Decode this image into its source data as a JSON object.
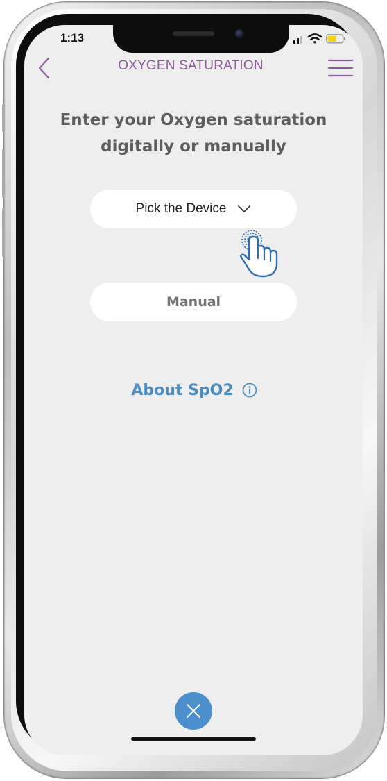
{
  "status_bar": {
    "time": "1:13",
    "battery_color": "#f5d30a"
  },
  "header": {
    "title": "OXYGEN SATURATION",
    "accent_color": "#8e5a9c",
    "back_icon": "chevron-left-icon",
    "menu_icon": "hamburger-menu-icon"
  },
  "main": {
    "heading_line1": "Enter your Oxygen saturation",
    "heading_line2": "digitally or manually",
    "device_select": {
      "label": "Pick the Device",
      "icon": "chevron-down-icon"
    },
    "manual_button": {
      "label": "Manual"
    },
    "about_link": {
      "label": "About SpO2",
      "icon": "info-icon",
      "color": "#4b8dc2"
    },
    "tap_indicator_icon": "tap-hand-icon"
  },
  "footer": {
    "close_icon": "close-icon",
    "close_color": "#4b8fcd"
  }
}
